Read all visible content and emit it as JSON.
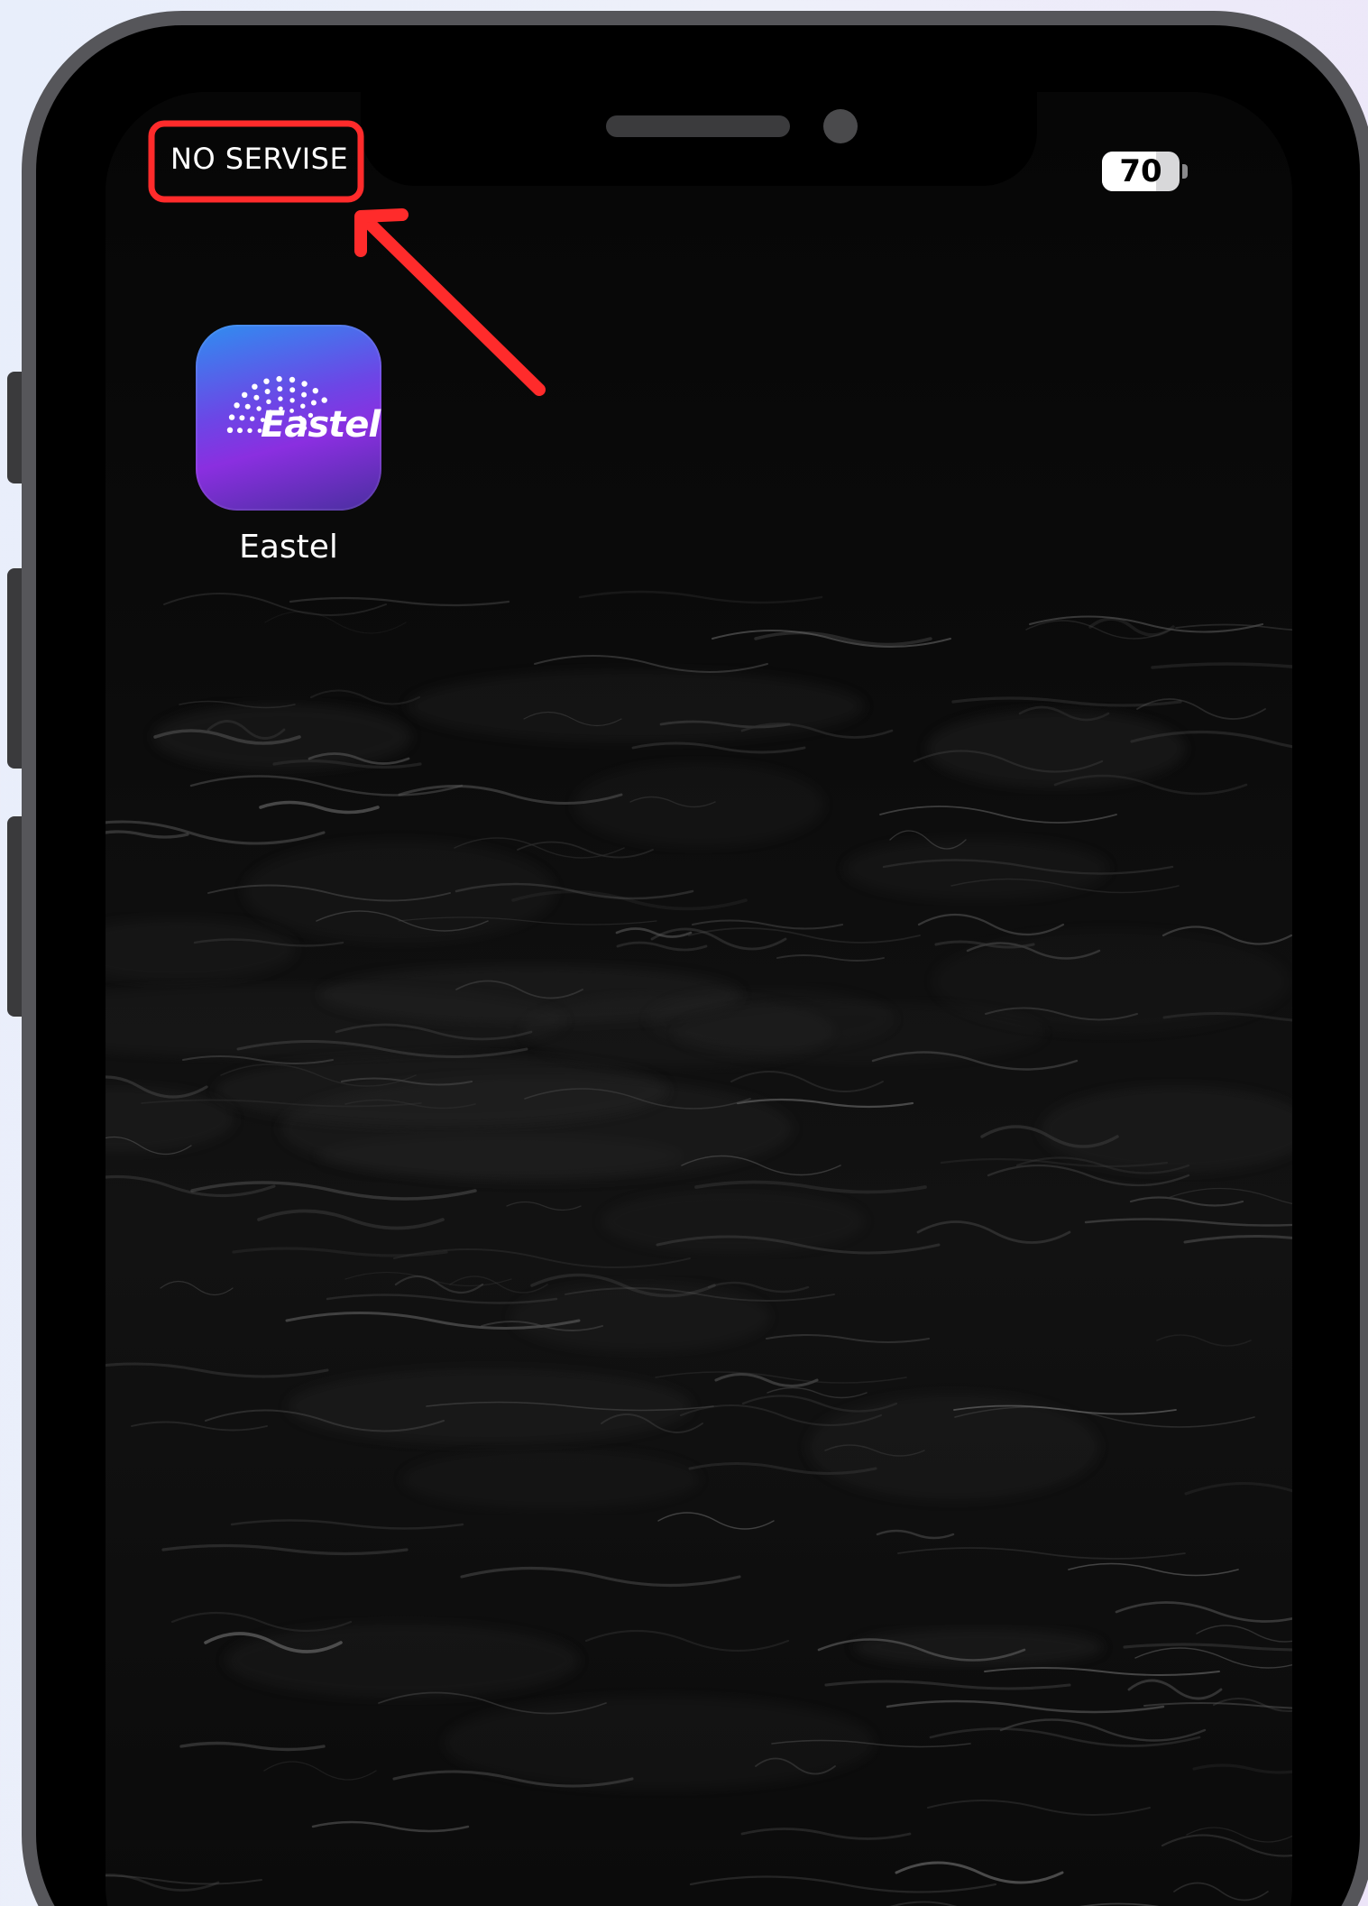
{
  "status_bar": {
    "carrier_text": "NO SERVISE",
    "battery_level": "70",
    "battery_fraction": 0.7
  },
  "home_screen": {
    "apps": [
      {
        "label": "Eastel",
        "logo_text": "Eastel",
        "icon": "eastel-logo-icon"
      }
    ]
  },
  "annotation": {
    "highlight_color": "#ff2b2b",
    "target": "status-carrier",
    "arrow_icon": "red-arrow-icon"
  },
  "colors": {
    "frame": "#56565a",
    "app_gradient_top": "#2f8ef0",
    "app_gradient_bottom": "#8a2fe0"
  }
}
